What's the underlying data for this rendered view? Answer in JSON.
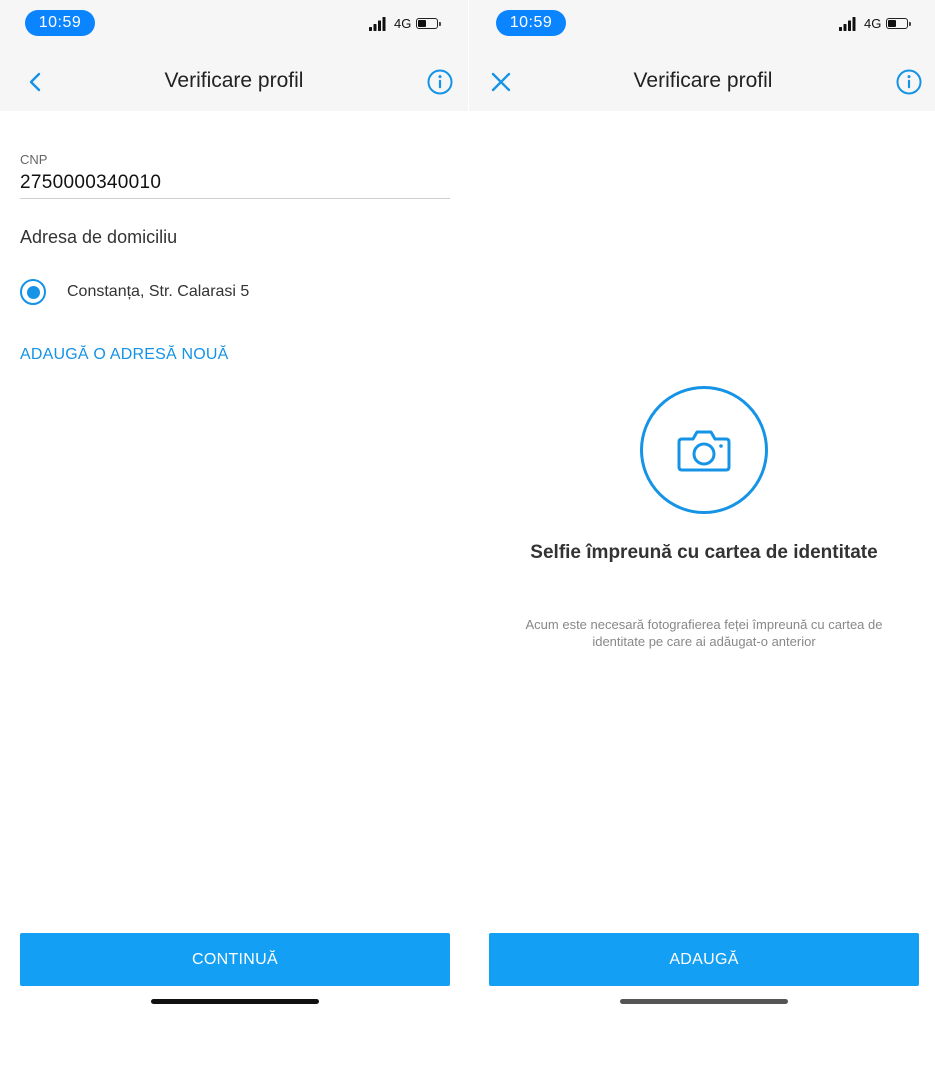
{
  "screens": [
    {
      "status": {
        "time": "10:59",
        "network": "4G"
      },
      "nav": {
        "title": "Verificare profil",
        "left_icon": "chevron-left-icon",
        "right_icon": "info-icon"
      },
      "cnp": {
        "label": "CNP",
        "value": "2750000340010"
      },
      "address_section": {
        "title": "Adresa de domiciliu"
      },
      "addresses": [
        {
          "label": "Constanța, Str. Calarasi 5",
          "selected": true
        }
      ],
      "add_address_link": "ADAUGĂ O ADRESĂ NOUĂ",
      "primary_button": "CONTINUĂ"
    },
    {
      "status": {
        "time": "10:59",
        "network": "4G"
      },
      "nav": {
        "title": "Verificare profil",
        "left_icon": "close-icon",
        "right_icon": "info-icon"
      },
      "camera_icon": "camera-icon",
      "heading": "Selfie împreună cu cartea de identitate",
      "description": "Acum este necesară fotografierea feței împreună cu cartea de identitate pe care ai adăugat-o anterior",
      "primary_button": "ADAUGĂ"
    }
  ],
  "colors": {
    "accent": "#1593e6",
    "button": "#139ff3",
    "time_pill": "#0a84ff",
    "topbar": "#f6f6f6"
  }
}
